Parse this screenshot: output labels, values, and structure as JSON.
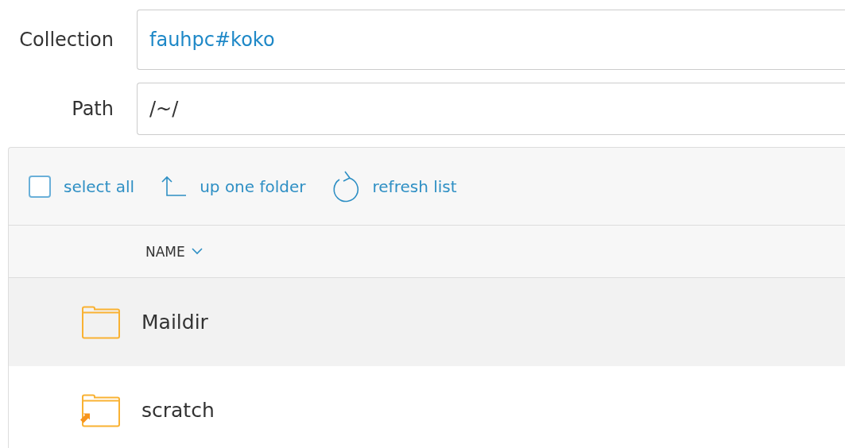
{
  "fields": [
    {
      "label": "Collection",
      "value": "fauhpc#koko",
      "kind": "link"
    },
    {
      "label": "Path",
      "value": "/~/",
      "kind": "text"
    }
  ],
  "toolbar": {
    "select_all": {
      "label": "select all",
      "checked": false
    },
    "up": "up one folder",
    "refresh": "refresh list"
  },
  "table": {
    "columns": [
      {
        "label": "NAME",
        "sorted": true
      }
    ],
    "rows": [
      {
        "name": "Maildir",
        "kind": "folder",
        "highlighted": true
      },
      {
        "name": "scratch",
        "kind": "link",
        "highlighted": false
      }
    ]
  }
}
